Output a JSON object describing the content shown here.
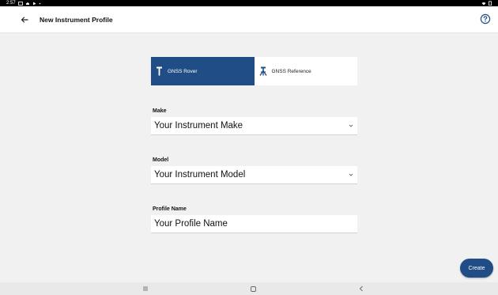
{
  "status_bar": {
    "time": "2:57",
    "icons": [
      "gallery-icon",
      "cloud-icon",
      "play-icon",
      "dot-icon"
    ],
    "right_icons": [
      "wifi-icon",
      "battery-icon"
    ]
  },
  "app_bar": {
    "title": "New Instrument Profile",
    "back_icon": "arrow-left-icon",
    "help_icon": "help-circle-icon"
  },
  "receiver_type": {
    "options": [
      {
        "label": "GNSS Rover",
        "icon": "rover-pole-icon",
        "selected": true
      },
      {
        "label": "GNSS Reference",
        "icon": "tripod-icon",
        "selected": false
      }
    ]
  },
  "form": {
    "make": {
      "label": "Make",
      "value": "Your Instrument Make"
    },
    "model": {
      "label": "Model",
      "value": "Your Instrument Model"
    },
    "profile_name": {
      "label": "Profile Name",
      "value": "Your Profile Name"
    }
  },
  "actions": {
    "create_label": "Create"
  },
  "colors": {
    "accent": "#204d86",
    "background": "#f1f1f1",
    "surface": "#ffffff",
    "status_bar": "#000000"
  },
  "nav_bar": {
    "icons": [
      "recents-icon",
      "home-icon",
      "back-icon"
    ]
  }
}
